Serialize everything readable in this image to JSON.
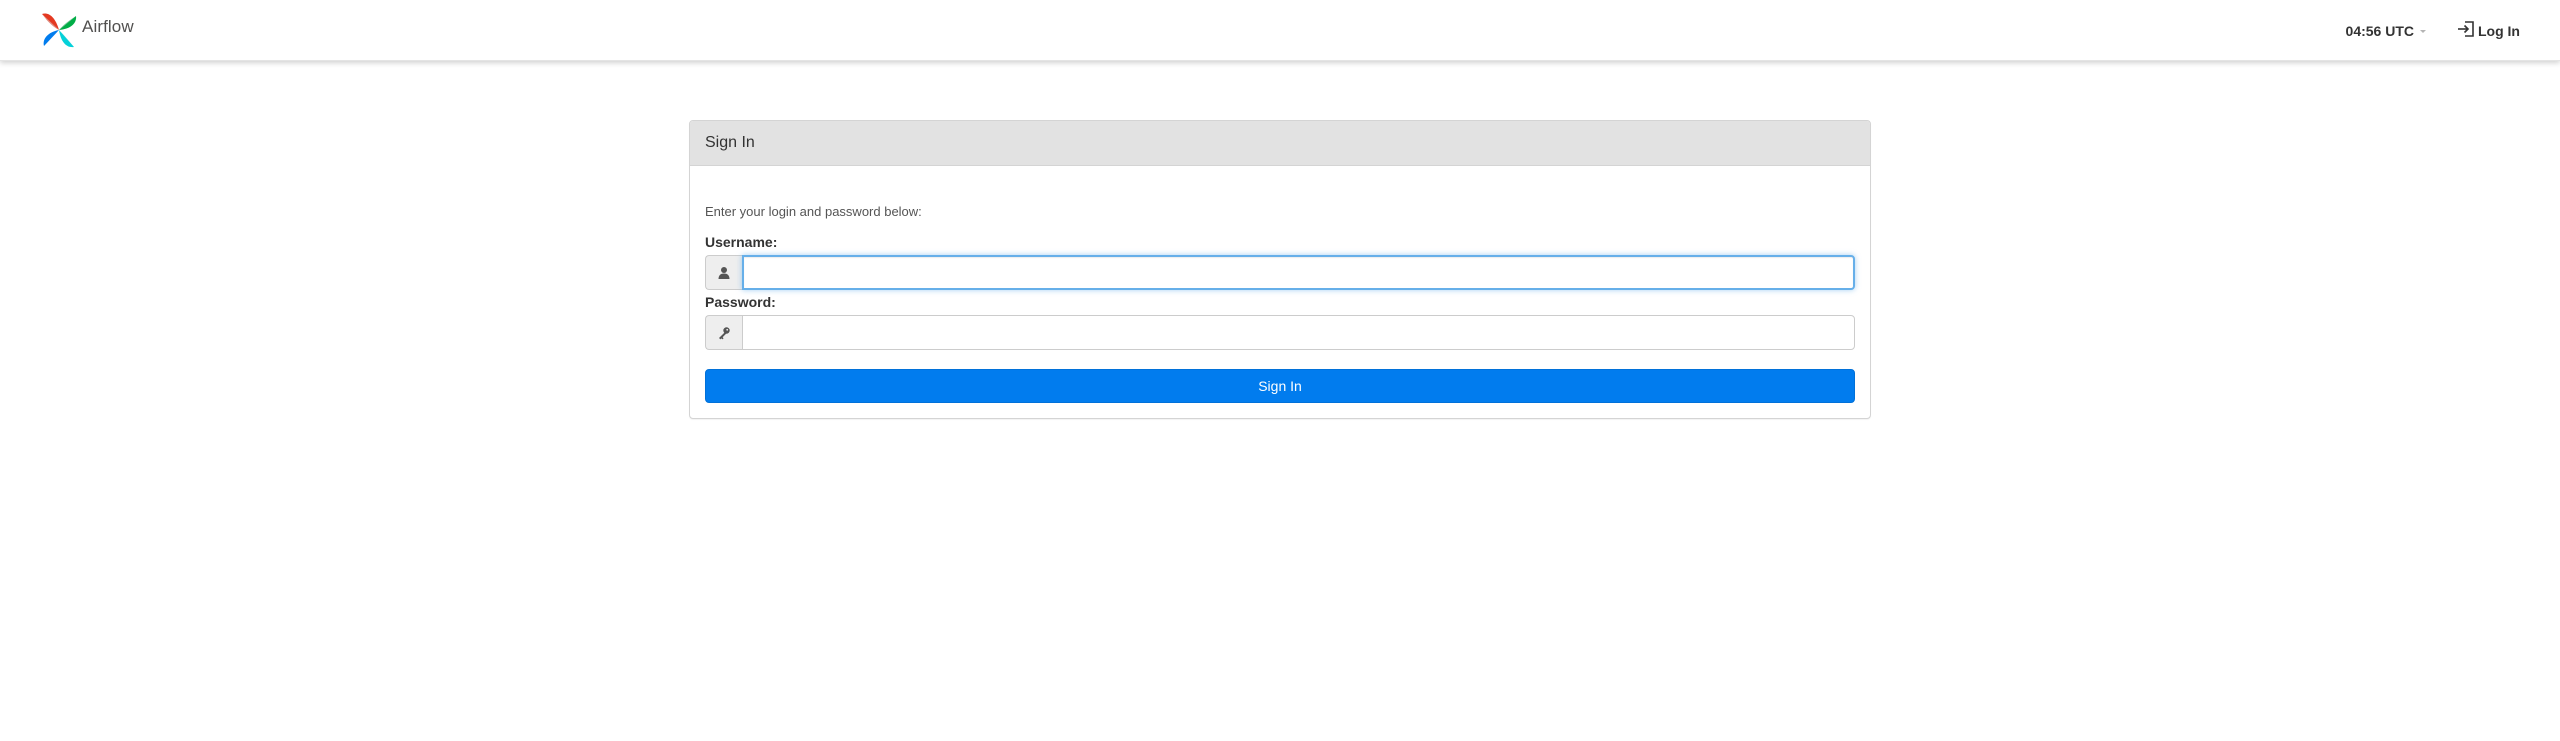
{
  "navbar": {
    "brand_name": "Airflow",
    "clock_text": "04:56 UTC",
    "login_label": "Log In"
  },
  "login_panel": {
    "title": "Sign In",
    "hint": "Enter your login and password below:",
    "username_label": "Username:",
    "username_value": "",
    "password_label": "Password:",
    "password_value": "",
    "submit_label": "Sign In"
  },
  "icons": {
    "brand": "airflow-pinwheel-logo",
    "clock_dropdown": "caret-down-icon",
    "login": "sign-in-icon",
    "username": "user-icon",
    "password": "key-icon"
  },
  "colors": {
    "primary_button": "#017cee",
    "panel_heading": "#e2e2e2",
    "focus_ring": "#66afe9"
  }
}
